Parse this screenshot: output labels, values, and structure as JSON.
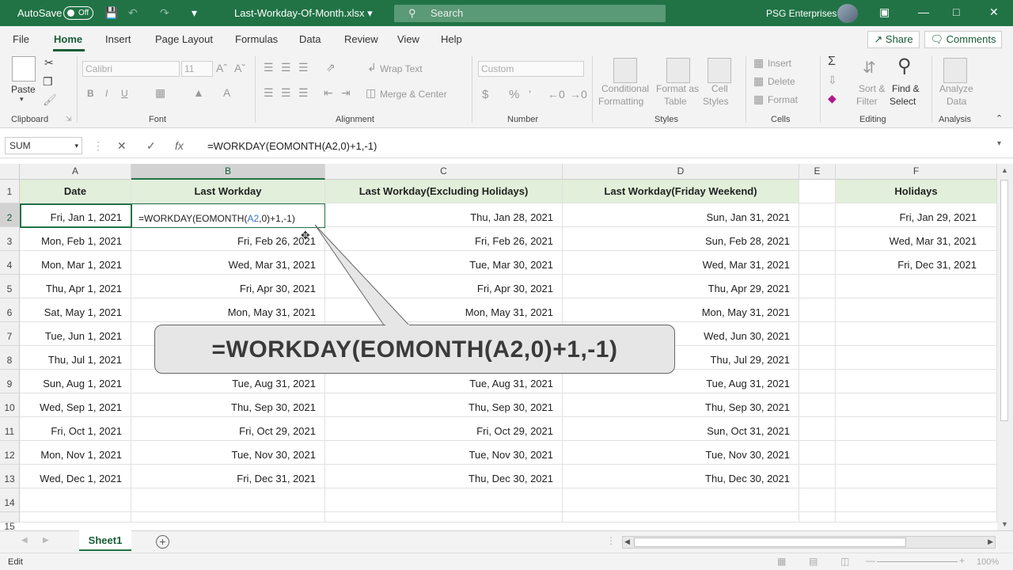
{
  "titlebar": {
    "autosave_label": "AutoSave",
    "autosave_state": "Off",
    "filename": "Last-Workday-Of-Month.xlsx",
    "search_placeholder": "Search",
    "account": "PSG Enterprises"
  },
  "menu": {
    "tabs": [
      "File",
      "Home",
      "Insert",
      "Page Layout",
      "Formulas",
      "Data",
      "Review",
      "View",
      "Help"
    ],
    "active": "Home",
    "share": "Share",
    "comments": "Comments"
  },
  "ribbon": {
    "clipboard": {
      "label": "Clipboard",
      "paste": "Paste"
    },
    "font": {
      "label": "Font",
      "name": "Calibri",
      "size": "11",
      "bold": "B",
      "italic": "I",
      "underline": "U"
    },
    "alignment": {
      "label": "Alignment",
      "wrap": "Wrap Text",
      "merge": "Merge & Center"
    },
    "number": {
      "label": "Number",
      "format": "Custom",
      "currency": "$",
      "percent": "%"
    },
    "styles": {
      "label": "Styles",
      "conditional_1": "Conditional",
      "conditional_2": "Formatting",
      "format_table_1": "Format as",
      "format_table_2": "Table",
      "cell_styles_1": "Cell",
      "cell_styles_2": "Styles"
    },
    "cells": {
      "label": "Cells",
      "insert": "Insert",
      "delete": "Delete",
      "format": "Format"
    },
    "editing": {
      "label": "Editing",
      "sort_1": "Sort &",
      "sort_2": "Filter",
      "find_1": "Find &",
      "find_2": "Select"
    },
    "analysis": {
      "label": "Analysis",
      "analyze_1": "Analyze",
      "analyze_2": "Data"
    }
  },
  "formula_bar": {
    "name_box": "SUM",
    "formula": "=WORKDAY(EOMONTH(A2,0)+1,-1)"
  },
  "sheet": {
    "columns": [
      "A",
      "B",
      "C",
      "D",
      "E",
      "F"
    ],
    "headers": [
      "Date",
      "Last Workday",
      "Last Workday(Excluding Holidays)",
      "Last Workday(Friday Weekend)",
      "",
      "Holidays"
    ],
    "rows": [
      [
        "Fri, Jan 1, 2021",
        "",
        "Thu, Jan 28, 2021",
        "Sun, Jan 31, 2021",
        "",
        "Fri, Jan 29, 2021"
      ],
      [
        "Mon, Feb 1, 2021",
        "Fri, Feb 26, 2021",
        "Fri, Feb 26, 2021",
        "Sun, Feb 28, 2021",
        "",
        "Wed, Mar 31, 2021"
      ],
      [
        "Mon, Mar 1, 2021",
        "Wed, Mar 31, 2021",
        "Tue, Mar 30, 2021",
        "Wed, Mar 31, 2021",
        "",
        "Fri, Dec 31, 2021"
      ],
      [
        "Thu, Apr 1, 2021",
        "Fri, Apr 30, 2021",
        "Fri, Apr 30, 2021",
        "Thu, Apr 29, 2021",
        "",
        ""
      ],
      [
        "Sat, May 1, 2021",
        "Mon, May 31, 2021",
        "Mon, May 31, 2021",
        "Mon, May 31, 2021",
        "",
        ""
      ],
      [
        "Tue, Jun 1, 2021",
        "",
        "",
        "Wed, Jun 30, 2021",
        "",
        ""
      ],
      [
        "Thu, Jul 1, 2021",
        "",
        "",
        "Thu, Jul 29, 2021",
        "",
        ""
      ],
      [
        "Sun, Aug 1, 2021",
        "Tue, Aug 31, 2021",
        "Tue, Aug 31, 2021",
        "Tue, Aug 31, 2021",
        "",
        ""
      ],
      [
        "Wed, Sep 1, 2021",
        "Thu, Sep 30, 2021",
        "Thu, Sep 30, 2021",
        "Thu, Sep 30, 2021",
        "",
        ""
      ],
      [
        "Fri, Oct 1, 2021",
        "Fri, Oct 29, 2021",
        "Fri, Oct 29, 2021",
        "Sun, Oct 31, 2021",
        "",
        ""
      ],
      [
        "Mon, Nov 1, 2021",
        "Tue, Nov 30, 2021",
        "Tue, Nov 30, 2021",
        "Tue, Nov 30, 2021",
        "",
        ""
      ],
      [
        "Wed, Dec 1, 2021",
        "Fri, Dec 31, 2021",
        "Thu, Dec 30, 2021",
        "Thu, Dec 30, 2021",
        "",
        ""
      ]
    ],
    "row_numbers": [
      "1",
      "2",
      "3",
      "4",
      "5",
      "6",
      "7",
      "8",
      "9",
      "10",
      "11",
      "12",
      "13",
      "14",
      "15"
    ],
    "editing_cell": {
      "prefix": "=WORKDAY(EOMONTH(",
      "ref": "A2",
      "suffix": ",0)+1,-1)"
    }
  },
  "callout": "=WORKDAY(EOMONTH(A2,0)+1,-1)",
  "sheet_tabs": [
    "Sheet1"
  ],
  "status": {
    "mode": "Edit",
    "zoom": "100%"
  },
  "colors": {
    "brand": "#217346",
    "header_fill": "#e2efda"
  }
}
